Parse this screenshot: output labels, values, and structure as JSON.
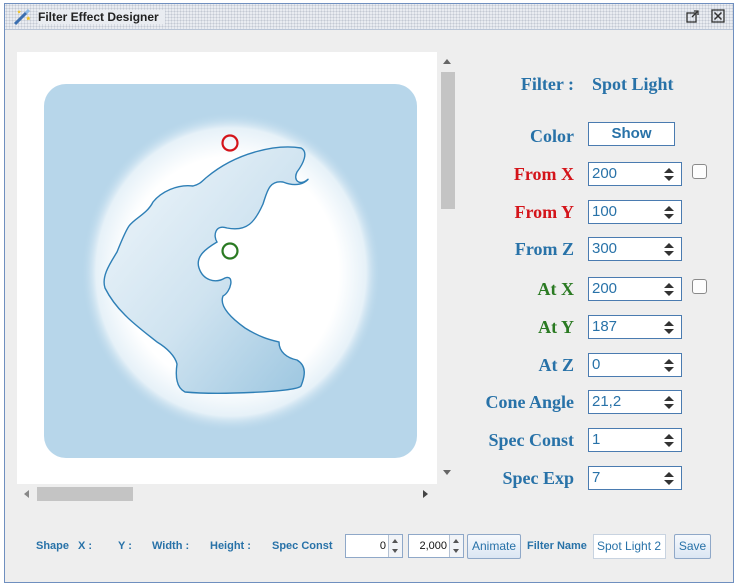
{
  "window": {
    "title": "Filter Effect Designer"
  },
  "panel": {
    "filter_label": "Filter :",
    "filter_value": "Spot Light",
    "color_label": "Color",
    "color_button": "Show",
    "fields": [
      {
        "label": "From X",
        "value": "200",
        "color": "#d4141a"
      },
      {
        "label": "From Y",
        "value": "100",
        "color": "#d4141a"
      },
      {
        "label": "From Z",
        "value": "300",
        "color": "#2872a8"
      },
      {
        "label": "At X",
        "value": "200",
        "color": "#2a7a22"
      },
      {
        "label": "At Y",
        "value": "187",
        "color": "#2a7a22"
      },
      {
        "label": "At Z",
        "value": "0",
        "color": "#2872a8"
      },
      {
        "label": "Cone Angle",
        "value": "21,2",
        "color": "#2872a8"
      },
      {
        "label": "Spec Const",
        "value": "1",
        "color": "#2872a8"
      },
      {
        "label": "Spec Exp",
        "value": "7",
        "color": "#2872a8"
      }
    ]
  },
  "bottom": {
    "shape_label": "Shape",
    "x_label": "X :",
    "y_label": "Y :",
    "width_label": "Width :",
    "height_label": "Height :",
    "spec_const_label": "Spec Const",
    "spin1_value": "0",
    "spin2_value": "2,000",
    "animate_button": "Animate",
    "filter_name_label": "Filter Name",
    "filter_name_value": "Spot Light 2",
    "save_button": "Save"
  },
  "colors": {
    "accent": "#2872a8",
    "from_marker": "#d4141a",
    "at_marker": "#2a7a22",
    "background_panel": "#b7d6ea"
  }
}
